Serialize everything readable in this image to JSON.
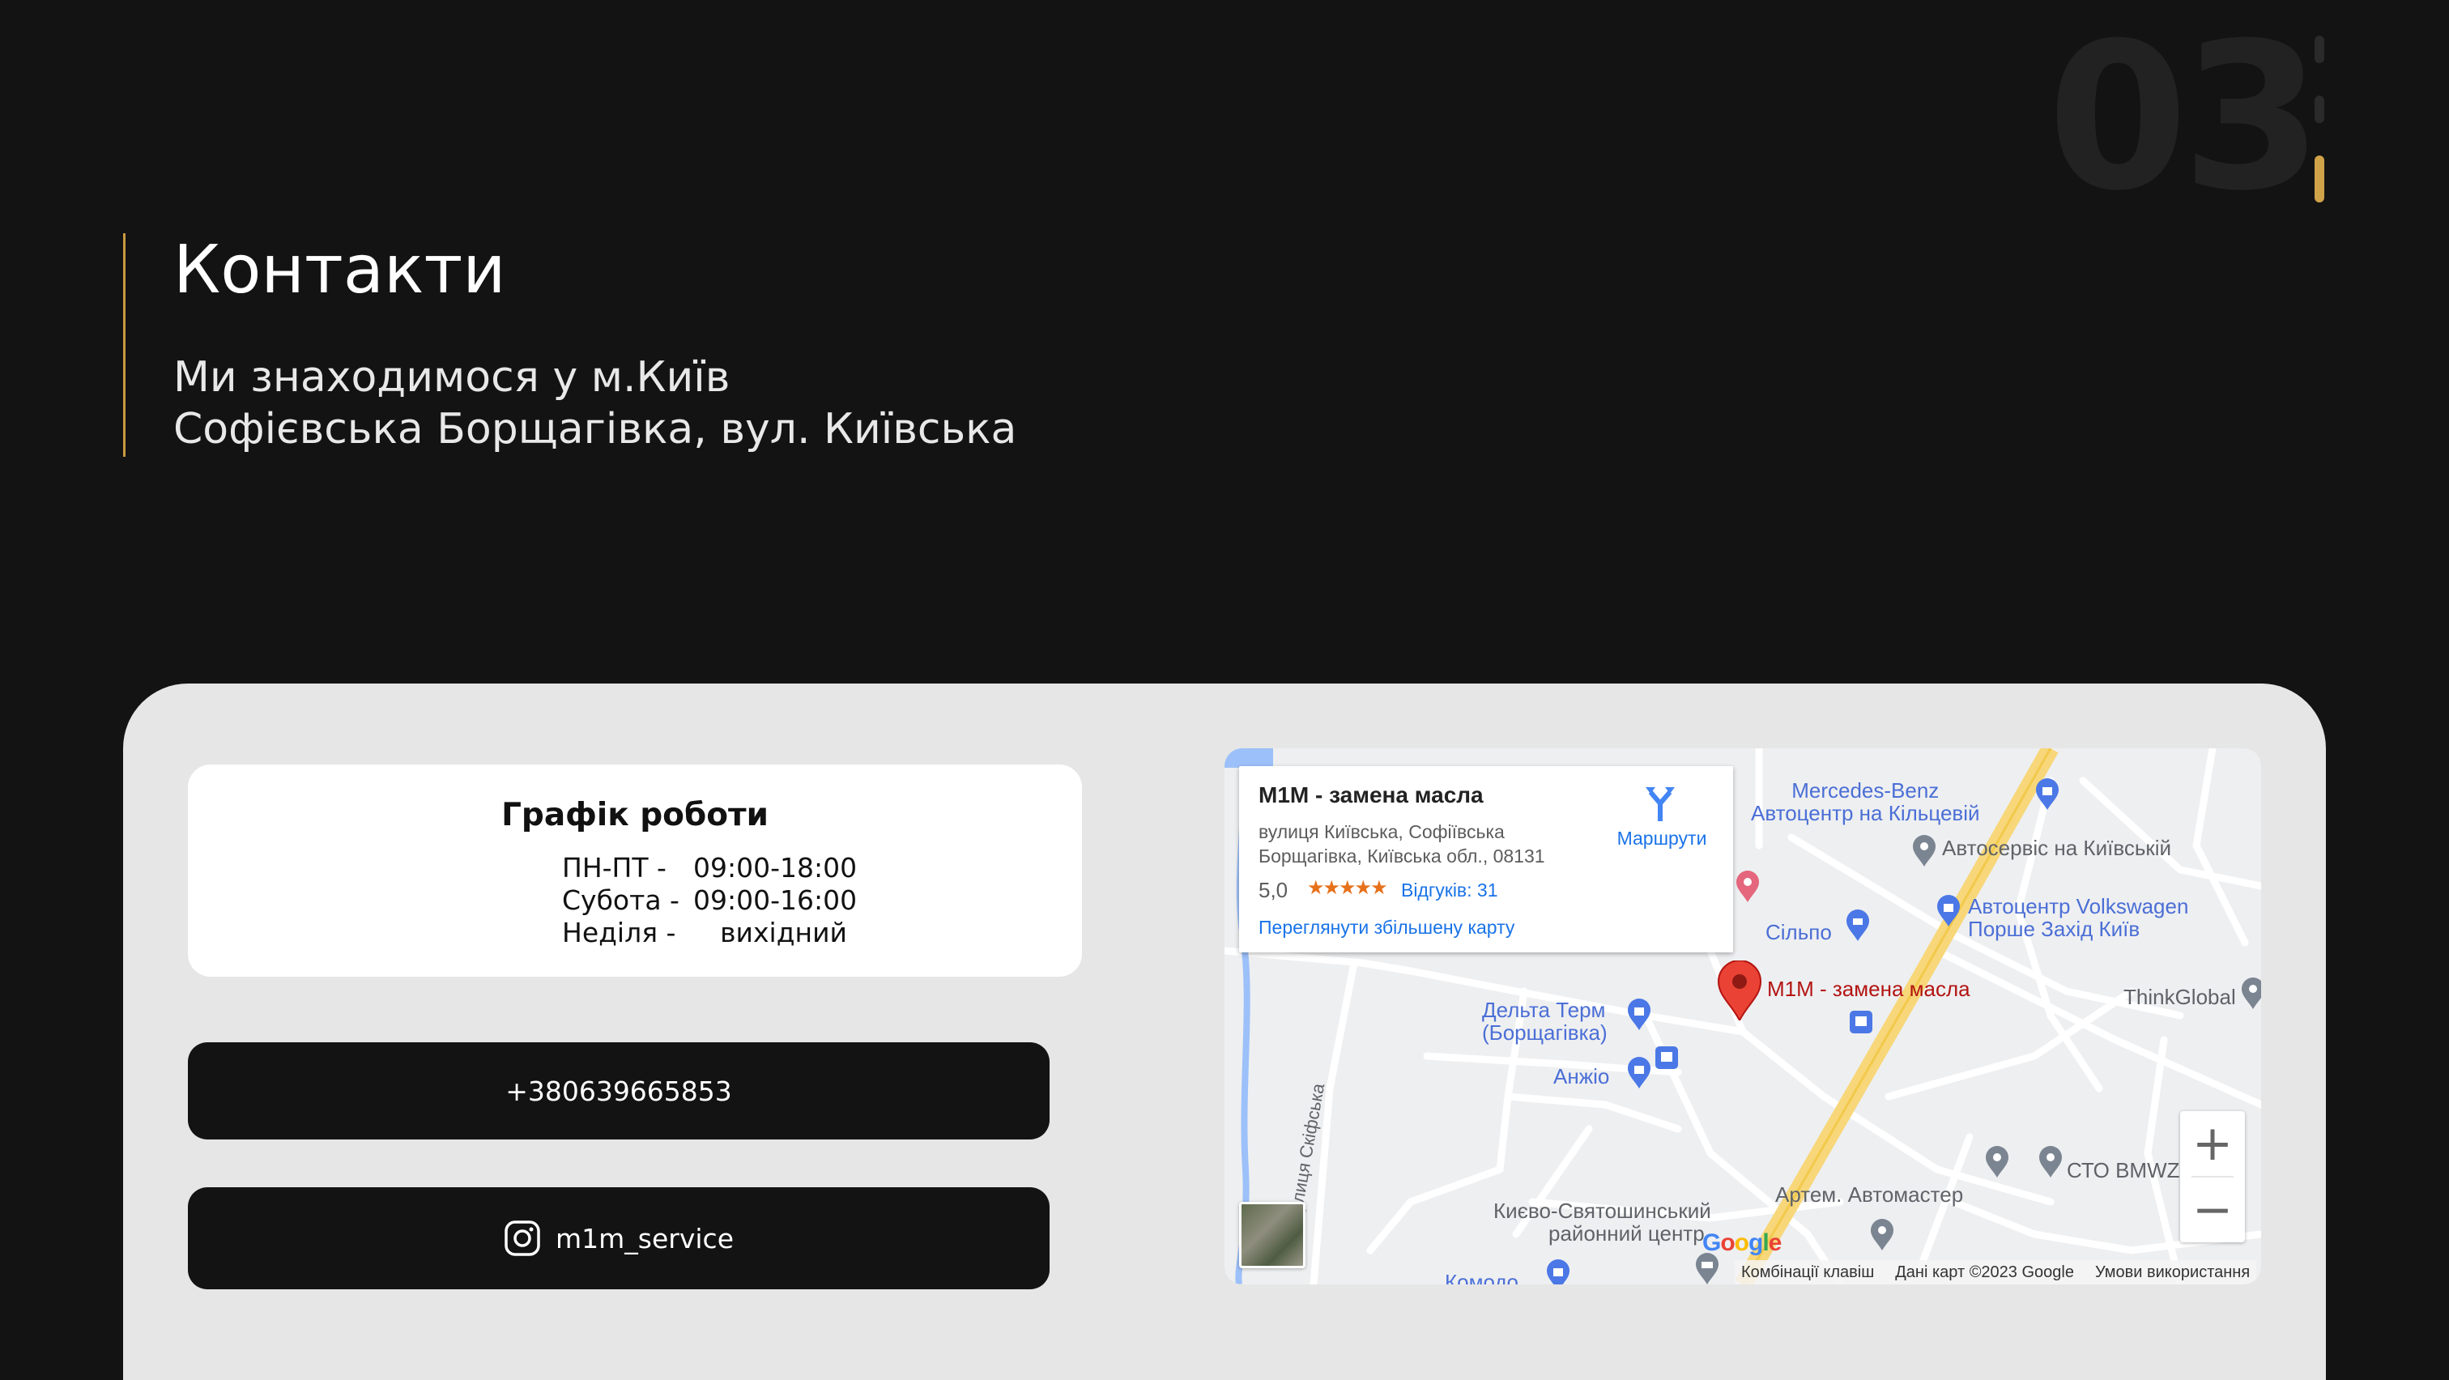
{
  "section": {
    "number": "03"
  },
  "header": {
    "title": "Контакти",
    "address_line1": "Ми знаходимося у м.Київ",
    "address_line2": "Софієвська Борщагівка, вул. Київська"
  },
  "schedule": {
    "title": "Графік роботи",
    "rows": [
      {
        "day": "ПН-ПТ -",
        "time": "09:00-18:00"
      },
      {
        "day": "Субота -",
        "time": "09:00-16:00"
      },
      {
        "day": "Неділя -",
        "time": "вихідний"
      }
    ]
  },
  "contacts": {
    "phone": "+380639665853",
    "instagram": "m1m_service"
  },
  "map": {
    "card": {
      "title": "M1M - замена масла",
      "address": "вулиця Київська, Софіївська Борщагівка, Київська обл., 08131",
      "rating": "5,0",
      "stars": "★★★★★",
      "reviews": "Відгуків: 31",
      "larger_map": "Переглянути збільшену карту",
      "directions": "Маршрути"
    },
    "places": {
      "mercedes": "Mercedes-Benz\nАвтоцентр на Кільцевій",
      "autoservice": "Автосервіс на Київській",
      "silpo": "Сільпо",
      "vw1": "Автоцентр Volkswagen",
      "vw2": "Порше Захід Київ",
      "thinkglobal": "ThinkGlobal",
      "pin": "M1M - замена масла",
      "delta1": "Дельта Терм",
      "delta2": "(Борщагівка)",
      "anzhio": "Анжіо",
      "street": "вулиця Скіфська",
      "sto": "СТО BMWZ",
      "artem": "Артем. Автомастер",
      "center1": "Києво-Святошинський",
      "center2": "районний центр",
      "komodo": "Комодо"
    },
    "zoom_in": "+",
    "zoom_out": "−",
    "google": "Google",
    "attribution": {
      "shortcuts": "Комбінації клавіш",
      "data": "Дані карт ©2023 Google",
      "terms": "Умови використання"
    }
  },
  "colors": {
    "accent": "#c99b3f",
    "background": "#141314",
    "panel": "#e6e6e6"
  }
}
